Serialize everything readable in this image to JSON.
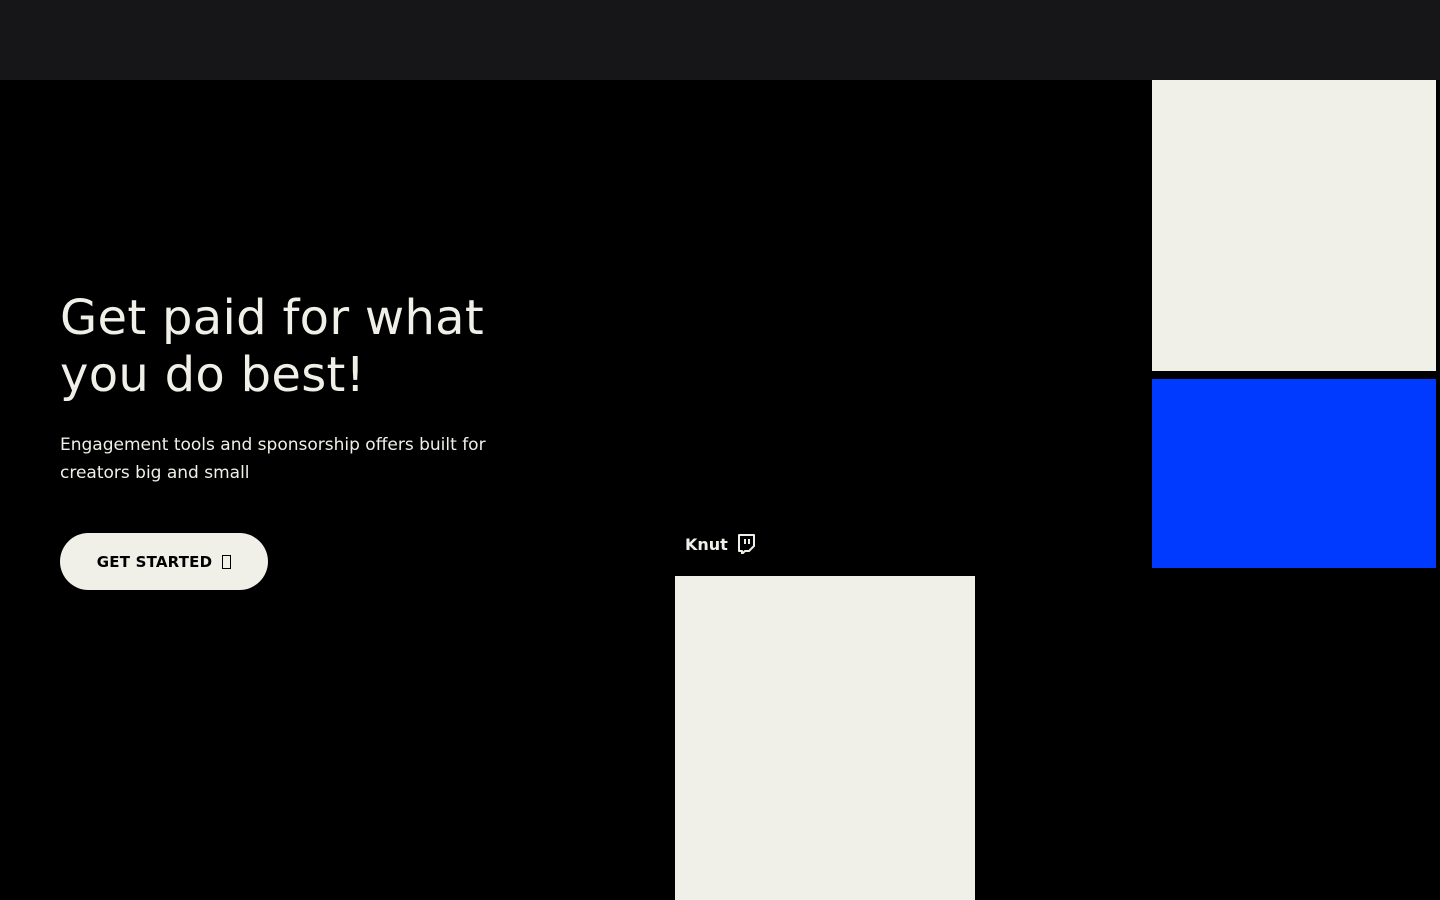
{
  "hero": {
    "title_line1": "Get paid for what",
    "title_line2": "you do best!",
    "subtitle": "Engagement tools and sponsorship offers built for creators big and small",
    "cta_label": "GET STARTED"
  },
  "creator": {
    "name": "Knut",
    "platform_icon": "twitch-icon"
  },
  "colors": {
    "background": "#000000",
    "topbar": "#161618",
    "cream": "#f0efe8",
    "accent_blue": "#0039ff"
  }
}
